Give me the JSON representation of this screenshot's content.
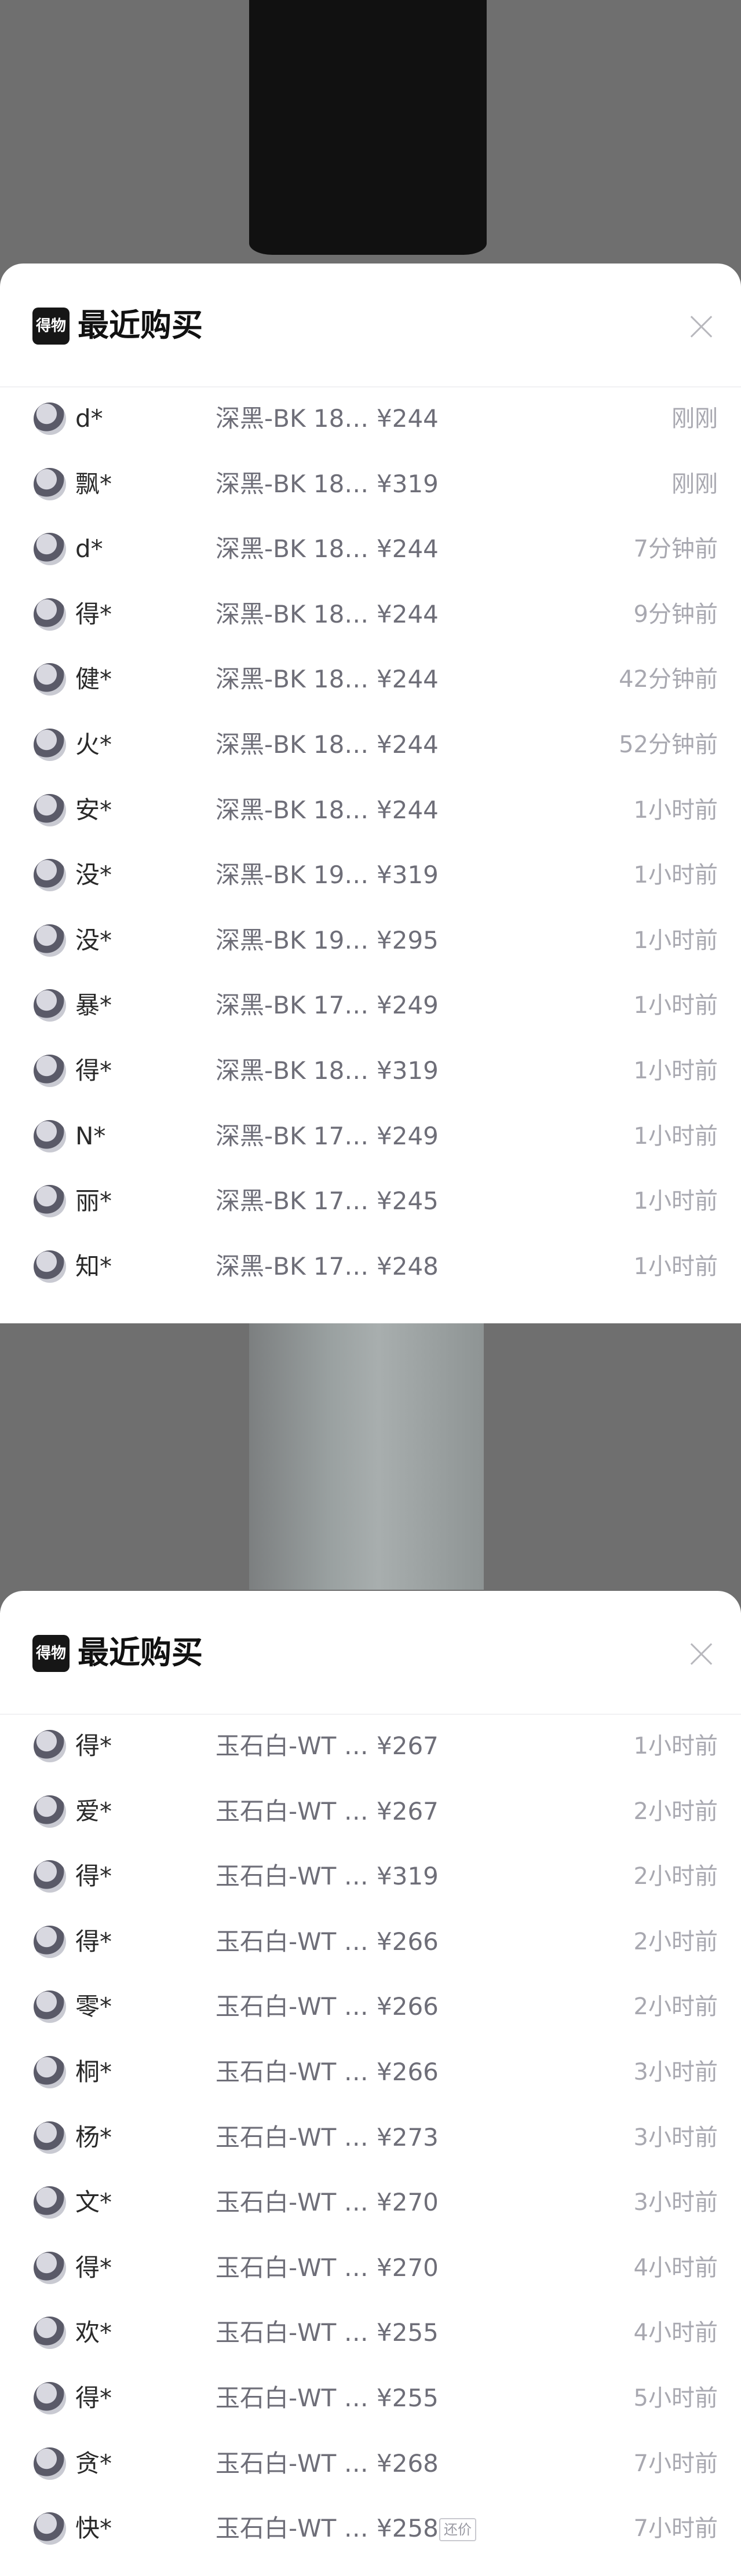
{
  "sections": [
    {
      "logo_text": "得物",
      "title": "最近购买",
      "rows": [
        {
          "name": "d*",
          "spec": "深黑-BK 18…",
          "price": "¥244",
          "time": "刚刚"
        },
        {
          "name": "飘*",
          "spec": "深黑-BK 18…",
          "price": "¥319",
          "time": "刚刚"
        },
        {
          "name": "d*",
          "spec": "深黑-BK 18…",
          "price": "¥244",
          "time": "7分钟前"
        },
        {
          "name": "得*",
          "spec": "深黑-BK 18…",
          "price": "¥244",
          "time": "9分钟前"
        },
        {
          "name": "健*",
          "spec": "深黑-BK 18…",
          "price": "¥244",
          "time": "42分钟前"
        },
        {
          "name": "火*",
          "spec": "深黑-BK 18…",
          "price": "¥244",
          "time": "52分钟前"
        },
        {
          "name": "安*",
          "spec": "深黑-BK 18…",
          "price": "¥244",
          "time": "1小时前"
        },
        {
          "name": "没*",
          "spec": "深黑-BK 19…",
          "price": "¥319",
          "time": "1小时前"
        },
        {
          "name": "没*",
          "spec": "深黑-BK 19…",
          "price": "¥295",
          "time": "1小时前"
        },
        {
          "name": "暴*",
          "spec": "深黑-BK 17…",
          "price": "¥249",
          "time": "1小时前"
        },
        {
          "name": "得*",
          "spec": "深黑-BK 18…",
          "price": "¥319",
          "time": "1小时前"
        },
        {
          "name": "N*",
          "spec": "深黑-BK 17…",
          "price": "¥249",
          "time": "1小时前"
        },
        {
          "name": "丽*",
          "spec": "深黑-BK 17…",
          "price": "¥245",
          "time": "1小时前"
        },
        {
          "name": "知*",
          "spec": "深黑-BK 17…",
          "price": "¥248",
          "time": "1小时前"
        }
      ]
    },
    {
      "logo_text": "得物",
      "title": "最近购买",
      "rows": [
        {
          "name": "得*",
          "spec": "玉石白-WT …",
          "price": "¥267",
          "time": "1小时前"
        },
        {
          "name": "爱*",
          "spec": "玉石白-WT …",
          "price": "¥267",
          "time": "2小时前"
        },
        {
          "name": "得*",
          "spec": "玉石白-WT …",
          "price": "¥319",
          "time": "2小时前"
        },
        {
          "name": "得*",
          "spec": "玉石白-WT …",
          "price": "¥266",
          "time": "2小时前"
        },
        {
          "name": "零*",
          "spec": "玉石白-WT …",
          "price": "¥266",
          "time": "2小时前"
        },
        {
          "name": "桐*",
          "spec": "玉石白-WT …",
          "price": "¥266",
          "time": "3小时前"
        },
        {
          "name": "杨*",
          "spec": "玉石白-WT …",
          "price": "¥273",
          "time": "3小时前"
        },
        {
          "name": "文*",
          "spec": "玉石白-WT …",
          "price": "¥270",
          "time": "3小时前"
        },
        {
          "name": "得*",
          "spec": "玉石白-WT …",
          "price": "¥270",
          "time": "4小时前"
        },
        {
          "name": "欢*",
          "spec": "玉石白-WT …",
          "price": "¥255",
          "time": "4小时前"
        },
        {
          "name": "得*",
          "spec": "玉石白-WT …",
          "price": "¥255",
          "time": "5小时前"
        },
        {
          "name": "贪*",
          "spec": "玉石白-WT …",
          "price": "¥268",
          "time": "7小时前"
        },
        {
          "name": "快*",
          "spec": "玉石白-WT …",
          "price": "¥258",
          "badge": "还价",
          "time": "7小时前"
        }
      ]
    }
  ]
}
